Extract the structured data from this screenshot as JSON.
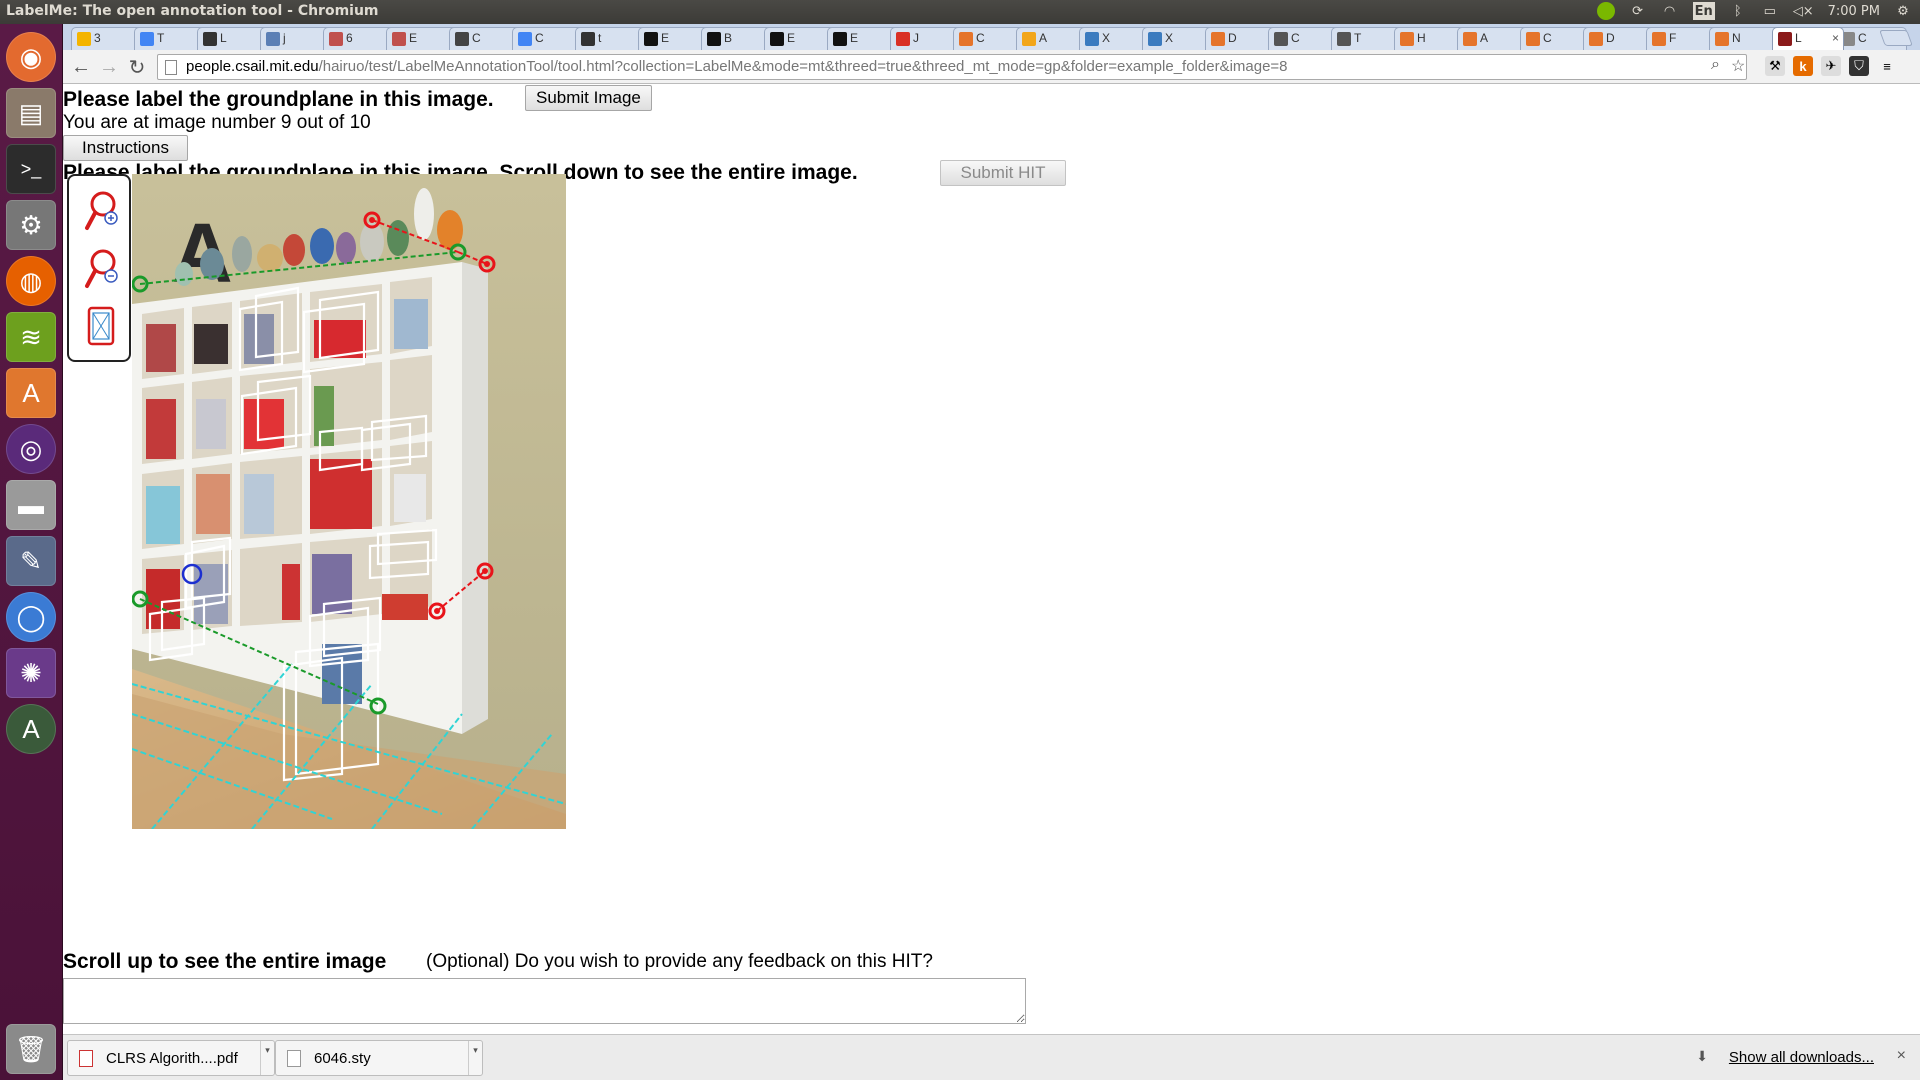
{
  "window": {
    "title": "LabelMe: The open annotation tool - Chromium"
  },
  "panel": {
    "keyboard": "En",
    "clock": "7:00 PM"
  },
  "tabs": [
    {
      "label": "3",
      "fav_color": "#f4b400"
    },
    {
      "label": "T",
      "fav_color": "#4285f4"
    },
    {
      "label": "L",
      "fav_color": "#333333"
    },
    {
      "label": "j",
      "fav_color": "#5b7fb5"
    },
    {
      "label": "6",
      "fav_color": "#c0504d"
    },
    {
      "label": "E",
      "fav_color": "#c0504d"
    },
    {
      "label": "C",
      "fav_color": "#444444"
    },
    {
      "label": "C",
      "fav_color": "#4285f4"
    },
    {
      "label": "t",
      "fav_color": "#333333"
    },
    {
      "label": "E",
      "fav_color": "#111111"
    },
    {
      "label": "B",
      "fav_color": "#111111"
    },
    {
      "label": "E",
      "fav_color": "#111111"
    },
    {
      "label": "E",
      "fav_color": "#111111"
    },
    {
      "label": "J",
      "fav_color": "#d93025"
    },
    {
      "label": "C",
      "fav_color": "#e5742b"
    },
    {
      "label": "A",
      "fav_color": "#f2a61b"
    },
    {
      "label": "X",
      "fav_color": "#3b7bbf"
    },
    {
      "label": "X",
      "fav_color": "#3b7bbf"
    },
    {
      "label": "D",
      "fav_color": "#e5742b"
    },
    {
      "label": "C",
      "fav_color": "#555555"
    },
    {
      "label": "T",
      "fav_color": "#555555"
    },
    {
      "label": "H",
      "fav_color": "#e5742b"
    },
    {
      "label": "A",
      "fav_color": "#e5742b"
    },
    {
      "label": "C",
      "fav_color": "#e5742b"
    },
    {
      "label": "D",
      "fav_color": "#e5742b"
    },
    {
      "label": "F",
      "fav_color": "#e5742b"
    },
    {
      "label": "N",
      "fav_color": "#e5742b"
    },
    {
      "label": "L",
      "fav_color": "#8b1a1a",
      "active": true
    },
    {
      "label": "C",
      "fav_color": "#888888"
    }
  ],
  "address_bar": {
    "host": "people.csail.mit.edu",
    "path": "/hairuo/test/LabelMeAnnotationTool/tool.html?collection=LabelMe&mode=mt&threed=true&threed_mt_mode=gp&folder=example_folder&image=8"
  },
  "page": {
    "heading": "Please label the groundplane in this image.",
    "submit_image_label": "Submit Image",
    "progress_text": "You are at image number 9 out of 10",
    "instructions_label": "Instructions",
    "scroll_down_text": "Please label the groundplane in this image. Scroll down to see the entire image.",
    "submit_hit_label": "Submit HIT",
    "scroll_up_text": "Scroll up to see the entire image",
    "feedback_prompt": "(Optional) Do you wish to provide any feedback on this HIT?",
    "feedback_value": ""
  },
  "tools": [
    "zoom-in-icon",
    "zoom-out-icon",
    "fit-to-window-icon"
  ],
  "downloads": {
    "items": [
      {
        "name": "CLRS Algorith....pdf",
        "type": "pdf"
      },
      {
        "name": "6046.sty",
        "type": "file"
      }
    ],
    "show_all_label": "Show all downloads...",
    "close": "×"
  },
  "colors": {
    "annotation_red": "#e8141a",
    "annotation_green": "#1a9a2a",
    "annotation_cyan": "#30d4d4",
    "annotation_blue": "#1c2fd0",
    "box_white": "#ffffff",
    "launcher_bg": "#5a1a46"
  }
}
